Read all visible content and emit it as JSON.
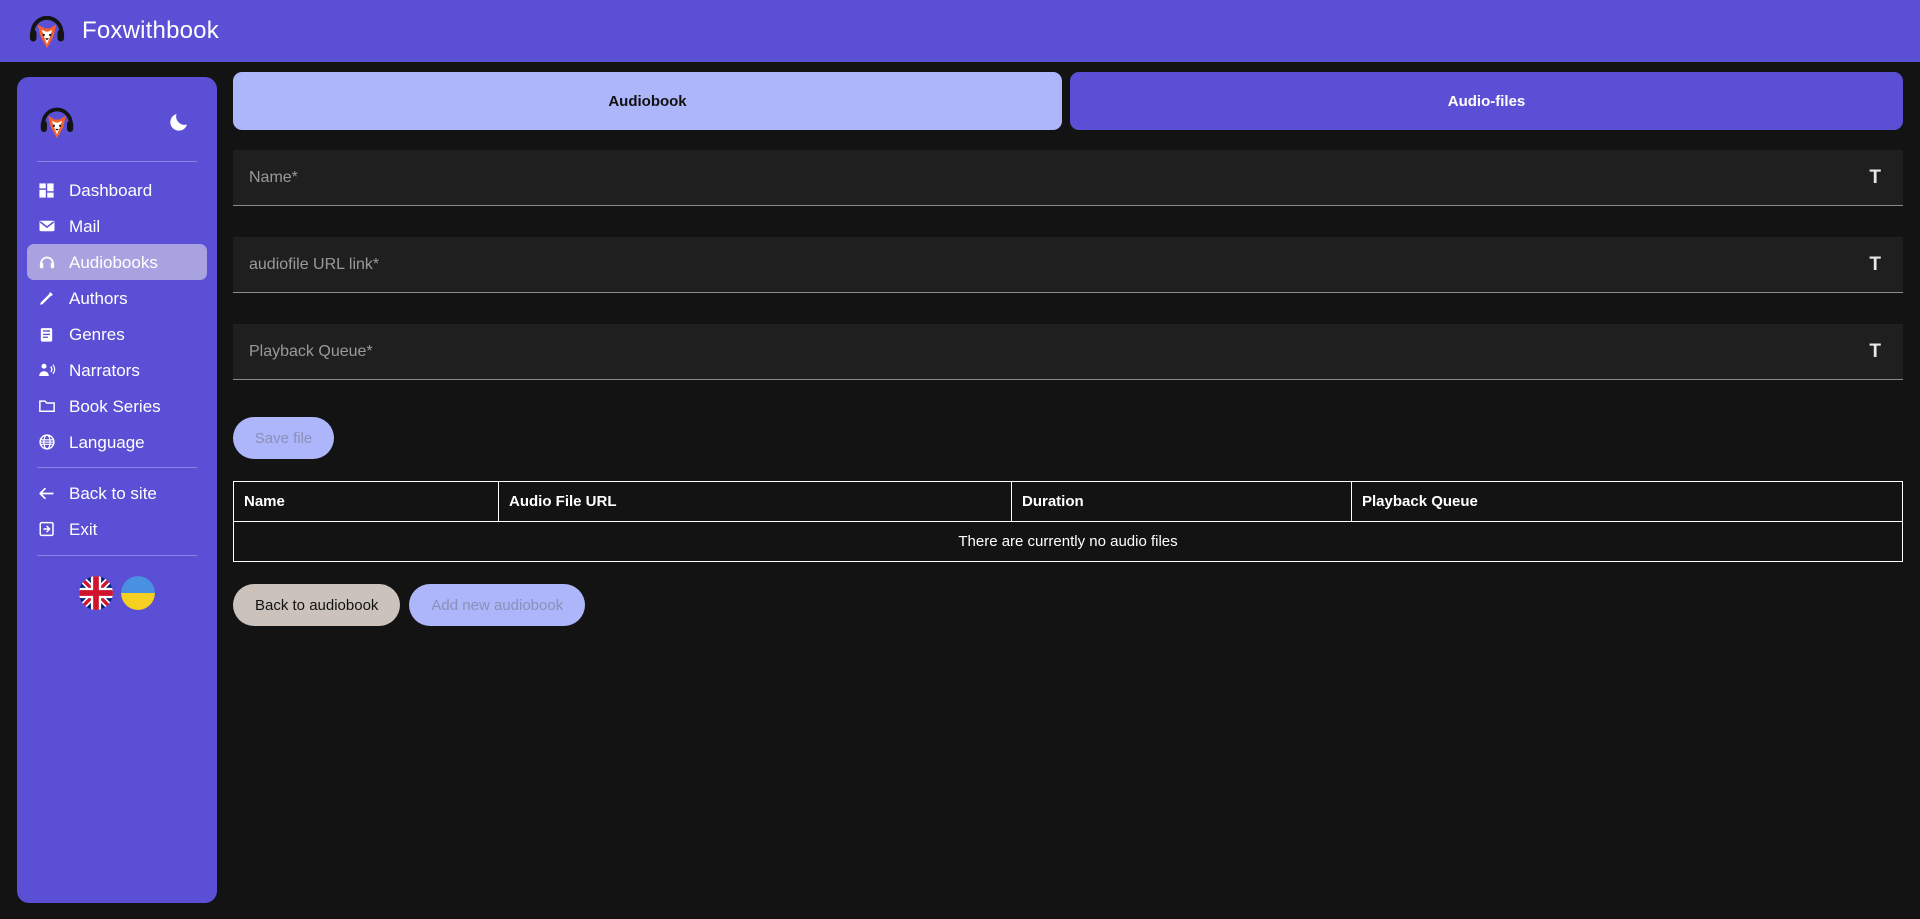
{
  "topbar": {
    "brand": "Foxwithbook",
    "logo_icon": "fox-headphones-logo"
  },
  "sidebar": {
    "logo_icon": "fox-headphones-logo",
    "theme_toggle_icon": "moon-icon",
    "items": [
      {
        "label": "Dashboard",
        "icon": "dashboard-icon",
        "active": false
      },
      {
        "label": "Mail",
        "icon": "mail-icon",
        "active": false
      },
      {
        "label": "Audiobooks",
        "icon": "headphones-icon",
        "active": true
      },
      {
        "label": "Authors",
        "icon": "pencil-icon",
        "active": false
      },
      {
        "label": "Genres",
        "icon": "clipboard-icon",
        "active": false
      },
      {
        "label": "Narrators",
        "icon": "person-voice-icon",
        "active": false
      },
      {
        "label": "Book Series",
        "icon": "folder-icon",
        "active": false
      },
      {
        "label": "Language",
        "icon": "globe-icon",
        "active": false
      },
      {
        "label": "Back to site",
        "icon": "arrow-left-icon",
        "active": false
      },
      {
        "label": "Exit",
        "icon": "exit-icon",
        "active": false
      }
    ],
    "flags": [
      {
        "name": "flag-uk",
        "title": "English"
      },
      {
        "name": "flag-ukraine",
        "title": "Ukrainian"
      }
    ]
  },
  "tabs": [
    {
      "label": "Audiobook",
      "selected": true
    },
    {
      "label": "Audio-files",
      "selected": false
    }
  ],
  "form": {
    "fields": [
      {
        "placeholder": "Name*",
        "value": "",
        "trailing_icon": "text-format-icon",
        "trailing_label": "T"
      },
      {
        "placeholder": "audiofile URL link*",
        "value": "",
        "trailing_icon": "text-format-icon",
        "trailing_label": "T"
      },
      {
        "placeholder": "Playback Queue*",
        "value": "",
        "trailing_icon": "text-format-icon",
        "trailing_label": "T"
      }
    ],
    "save_label": "Save file"
  },
  "table": {
    "columns": [
      "Name",
      "Audio File URL",
      "Duration",
      "Playback Queue"
    ],
    "rows": [],
    "empty_message": "There are currently no audio files"
  },
  "bottom_actions": {
    "back_label": "Back to audiobook",
    "add_label": "Add new audiobook"
  },
  "colors": {
    "brand_purple": "#5B4FD6",
    "tab_active": "#AEB6FB",
    "sidebar_active": "#A9A2E0",
    "page_background": "#131313",
    "field_background": "#1F1F1F",
    "button_beige": "#CBC3BB"
  }
}
